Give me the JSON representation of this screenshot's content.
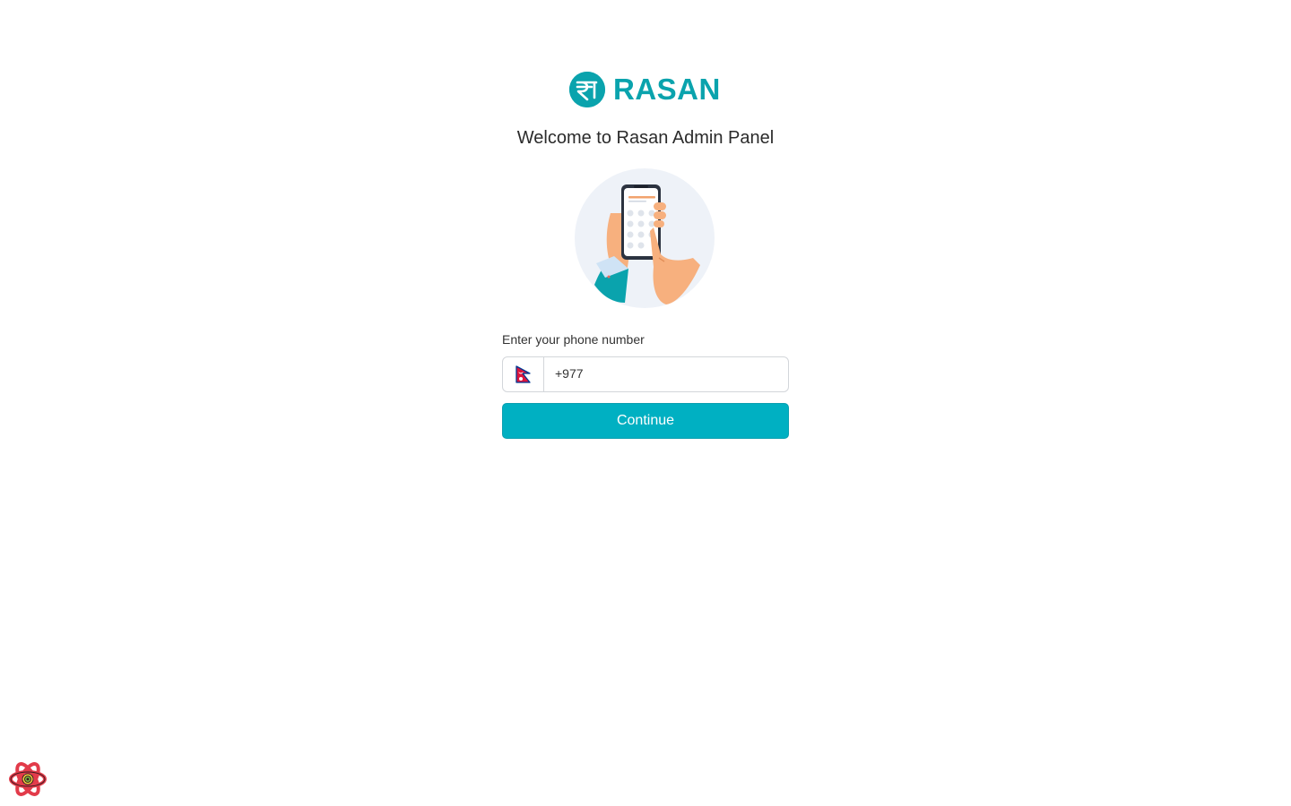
{
  "brand": {
    "name": "RASAN",
    "symbol": "₹",
    "color": "#0aa3ad"
  },
  "welcome": {
    "title": "Welcome to Rasan Admin Panel"
  },
  "illustration": {
    "icon": "phone-in-hand-illustration"
  },
  "phone_form": {
    "label": "Enter your phone number",
    "country_flag": "nepal-flag-icon",
    "value": "+977",
    "submit_label": "Continue",
    "accent_color": "#00b0c2"
  },
  "devtools": {
    "icon": "react-query-devtools-icon"
  }
}
